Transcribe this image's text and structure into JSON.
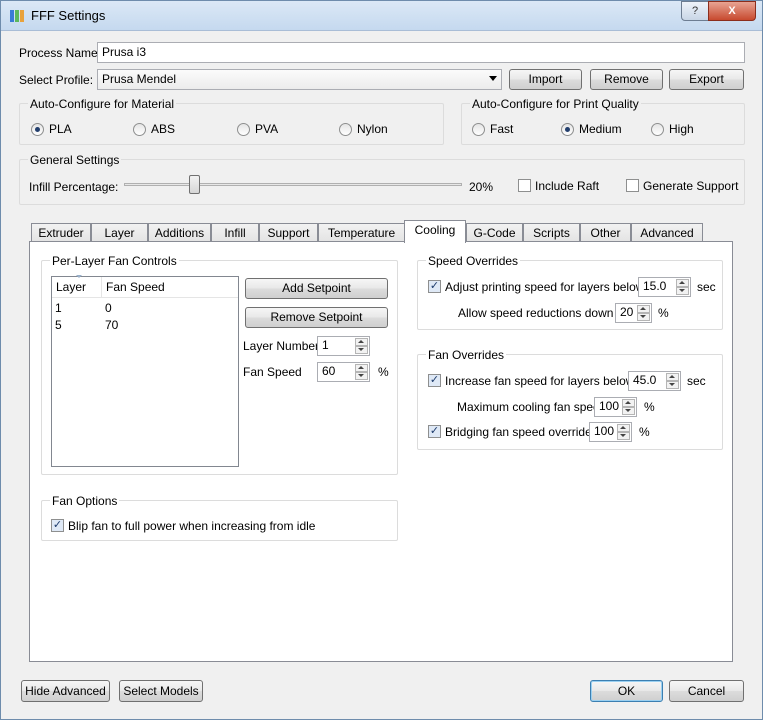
{
  "window": {
    "title": "FFF Settings",
    "help_btn": "?",
    "close_btn": "X"
  },
  "process": {
    "label": "Process Name:",
    "value": "Prusa i3"
  },
  "profile": {
    "label": "Select Profile:",
    "value": "Prusa Mendel",
    "import": "Import",
    "remove": "Remove",
    "export": "Export"
  },
  "material": {
    "title": "Auto-Configure for Material",
    "options": [
      "PLA",
      "ABS",
      "PVA",
      "Nylon"
    ],
    "selected": "PLA"
  },
  "quality": {
    "title": "Auto-Configure for Print Quality",
    "options": [
      "Fast",
      "Medium",
      "High"
    ],
    "selected": "Medium"
  },
  "general": {
    "title": "General Settings",
    "infill_label": "Infill Percentage:",
    "infill_value": "20%",
    "infill_fraction": 0.2,
    "include_raft": "Include Raft",
    "generate_support": "Generate Support"
  },
  "tabs": [
    "Extruder",
    "Layer",
    "Additions",
    "Infill",
    "Support",
    "Temperature",
    "Cooling",
    "G-Code",
    "Scripts",
    "Other",
    "Advanced"
  ],
  "active_tab": "Cooling",
  "fan_controls": {
    "title": "Per-Layer Fan Controls",
    "columns": [
      "Layer",
      "Fan Speed"
    ],
    "rows": [
      [
        "1",
        "0"
      ],
      [
        "5",
        "70"
      ]
    ],
    "add": "Add Setpoint",
    "remove": "Remove Setpoint",
    "layer_number_label": "Layer Number",
    "layer_number_value": "1",
    "fan_speed_label": "Fan Speed",
    "fan_speed_value": "60",
    "fan_speed_unit": "%"
  },
  "speed_overrides": {
    "title": "Speed Overrides",
    "adjust_label": "Adjust printing speed for layers below",
    "adjust_value": "15.0",
    "adjust_unit": "sec",
    "allow_label": "Allow speed reductions down to",
    "allow_value": "20",
    "allow_unit": "%"
  },
  "fan_overrides": {
    "title": "Fan Overrides",
    "increase_label": "Increase fan speed for layers below",
    "increase_value": "45.0",
    "increase_unit": "sec",
    "max_label": "Maximum cooling fan speed",
    "max_value": "100",
    "max_unit": "%",
    "bridging_label": "Bridging fan speed override",
    "bridging_value": "100",
    "bridging_unit": "%"
  },
  "fan_options": {
    "title": "Fan Options",
    "blip_label": "Blip fan to full power when increasing from idle"
  },
  "footer": {
    "hide_advanced": "Hide Advanced",
    "select_models": "Select Models",
    "ok": "OK",
    "cancel": "Cancel"
  }
}
